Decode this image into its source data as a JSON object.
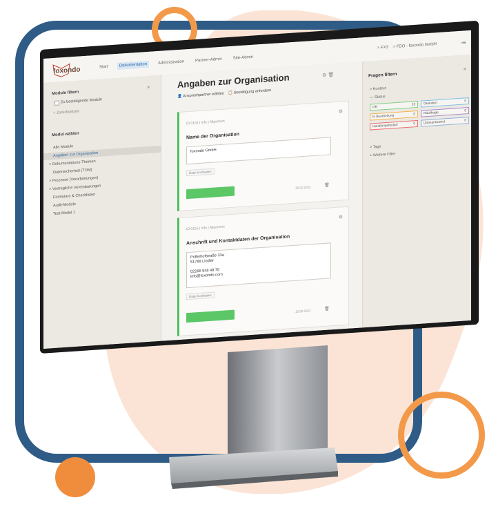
{
  "app": {
    "logo_text": "foxondo"
  },
  "nav": {
    "items": [
      "Start",
      "Dokumentation",
      "Administration",
      "Partner-Admin",
      "Site-Admin"
    ],
    "active_index": 1
  },
  "breadcrumbs": {
    "a": "> FX3",
    "b": "> FDO - foxondo GmbH"
  },
  "sidebar": {
    "filter_title": "Module filtern",
    "checkbox_label": "Zu bestätigende Module",
    "reset_link": "+ Zurücksetzen",
    "select_title": "Modul wählen",
    "items": [
      "Alle Module",
      "Angaben zur Organisation",
      "> Dokumentations-Themen",
      "Datensicherheit (TOM)",
      "> Prozesse (Verarbeitungen)",
      "> Vertragliche Vereinbarungen",
      "Formulare & Checklisten",
      "Audit-Module",
      "Test-Modul 1"
    ],
    "selected_index": 1
  },
  "main": {
    "title": "Angaben zur Organisation",
    "action_contact": "Ansprechpartner wählen",
    "action_confirm": "Bestätigung anfordern",
    "cards": [
      {
        "meta": "ID 0155 | Info | Allgemein",
        "question": "Name der Organisation",
        "answer": "foxondo GmbH",
        "history_btn": "Datei hochladen",
        "date": "15.02.2022"
      },
      {
        "meta": "ID 0155 | Info | Allgemein",
        "question": "Anschrift und Kontaktdaten der Organisation",
        "answer": "Pollerhofstraße 33a\n51789 Lindlar\n\n02266 948 48 70\ninfo@foxondo.com",
        "history_btn": "Datei hochladen",
        "date": "15.02.2022"
      }
    ]
  },
  "filter": {
    "title": "Fragen filtern",
    "kontext": "> Kontext",
    "status": "— Status",
    "chips": [
      {
        "label": "OK",
        "count": "13",
        "color": "#7fcf86"
      },
      {
        "label": "Geändert",
        "count": "0",
        "color": "#7cc0e6"
      },
      {
        "label": "In Bearbeitung",
        "count": "0",
        "color": "#f0b34a"
      },
      {
        "label": "Rückfrage",
        "count": "0",
        "color": "#a389c9"
      },
      {
        "label": "Handlungsbedarf",
        "count": "0",
        "color": "#e86d6d"
      },
      {
        "label": "Unbeantwortet",
        "count": "0",
        "color": "#8fb0d9"
      }
    ],
    "tags": "> Tags",
    "more": "> Weitere Filter"
  },
  "colors": {
    "frame": "#2f5c86",
    "accent": "#f39a4a",
    "blob": "#fbe4d6"
  }
}
